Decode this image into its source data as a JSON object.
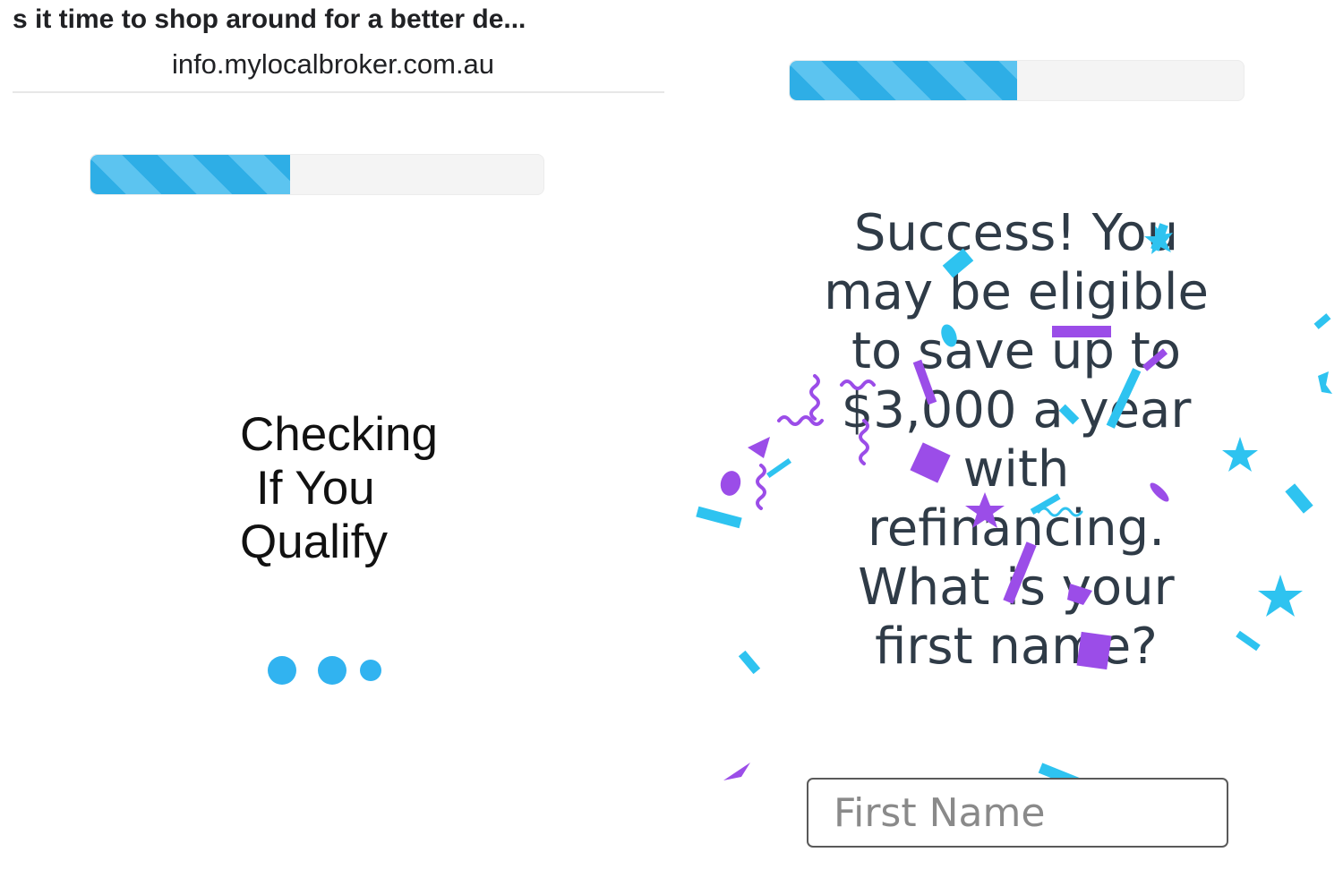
{
  "browser": {
    "title": "s it time to shop around for a better de...",
    "url": "info.mylocalbroker.com.au"
  },
  "loading_screen": {
    "progress_percent": 44,
    "checking_lines": [
      "Checking",
      "If You",
      "Qualify"
    ]
  },
  "success_screen": {
    "progress_percent": 50,
    "message_lines": [
      "Success! You",
      "may be eligible",
      "to save up to",
      "$3,000 a year",
      "with",
      "refinancing.",
      "What is your",
      "first name?"
    ],
    "first_name_input": {
      "placeholder": "First Name",
      "value": ""
    }
  },
  "colors": {
    "accent_blue": "#2eaee6",
    "dot_blue": "#31b3f0",
    "confetti_blue": "#2ec3f0",
    "confetti_purple": "#9b4de8",
    "text_dark": "#2f3b47"
  }
}
